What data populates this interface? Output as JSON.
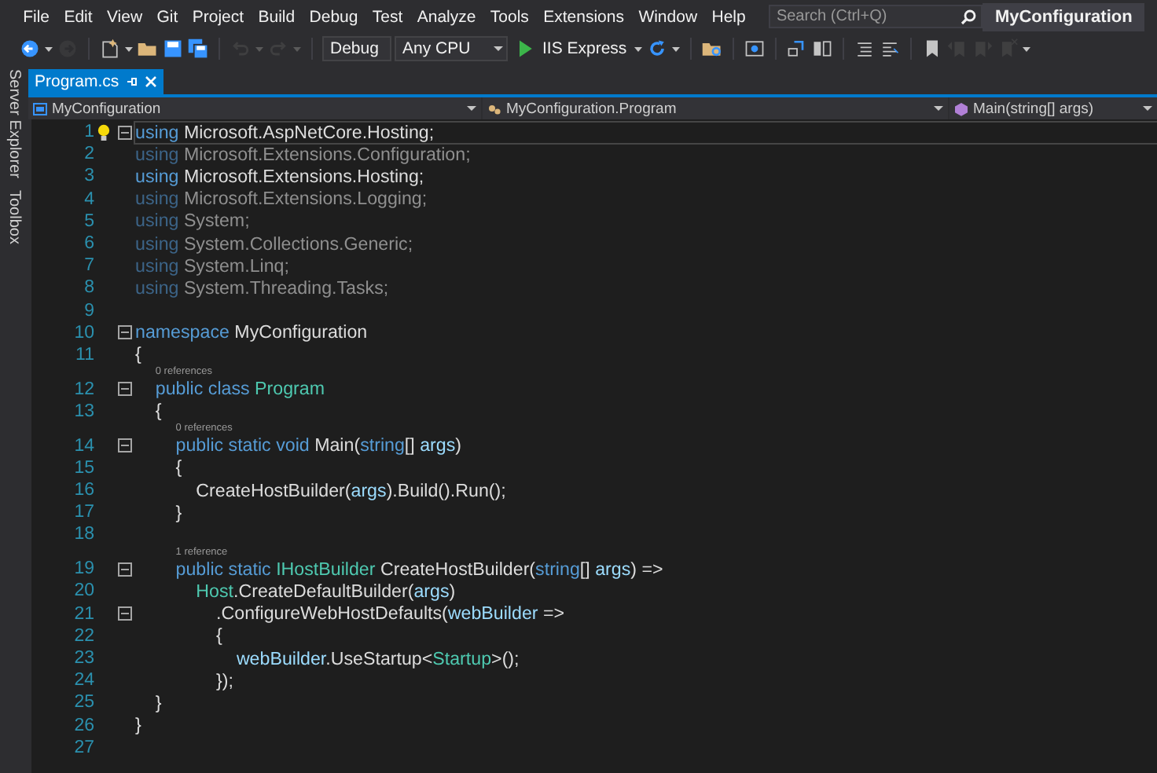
{
  "title_bar": {
    "menu": [
      "File",
      "Edit",
      "View",
      "Git",
      "Project",
      "Build",
      "Debug",
      "Test",
      "Analyze",
      "Tools",
      "Extensions",
      "Window",
      "Help"
    ],
    "search": {
      "placeholder": "Search (Ctrl+Q)"
    },
    "solution": "MyConfiguration"
  },
  "toolbar": [
    {
      "kind": "back",
      "disabled": false
    },
    {
      "kind": "caret",
      "disabled": false
    },
    {
      "kind": "forward",
      "disabled": true
    },
    {
      "kind": "sep"
    },
    {
      "kind": "new",
      "disabled": false
    },
    {
      "kind": "caret",
      "disabled": false
    },
    {
      "kind": "open",
      "disabled": false
    },
    {
      "kind": "save",
      "disabled": false
    },
    {
      "kind": "save-all",
      "disabled": false
    },
    {
      "kind": "sep"
    },
    {
      "kind": "undo",
      "disabled": true
    },
    {
      "kind": "caret",
      "disabled": true
    },
    {
      "kind": "redo",
      "disabled": true
    },
    {
      "kind": "caret",
      "disabled": true
    },
    {
      "kind": "sep"
    },
    {
      "kind": "combo",
      "text": "Debug",
      "disabled": false
    },
    {
      "kind": "combo",
      "text": "Any CPU",
      "disabled": false
    },
    {
      "kind": "run",
      "text": "IIS Express",
      "disabled": false
    },
    {
      "kind": "caret",
      "disabled": false
    },
    {
      "kind": "refresh",
      "disabled": false
    },
    {
      "kind": "caret",
      "disabled": false
    },
    {
      "kind": "sep"
    },
    {
      "kind": "find",
      "disabled": false
    },
    {
      "kind": "sep"
    },
    {
      "kind": "browse",
      "disabled": false
    },
    {
      "kind": "sep"
    },
    {
      "kind": "step",
      "disabled": false
    },
    {
      "kind": "layout",
      "disabled": false
    },
    {
      "kind": "sep"
    },
    {
      "kind": "comment",
      "disabled": false
    },
    {
      "kind": "uncomment",
      "disabled": false
    },
    {
      "kind": "sep"
    },
    {
      "kind": "bookmark",
      "disabled": false
    },
    {
      "kind": "bookmark-prev",
      "disabled": true
    },
    {
      "kind": "bookmark-next",
      "disabled": true
    },
    {
      "kind": "bookmark-clear",
      "disabled": true
    },
    {
      "kind": "caret",
      "disabled": false
    }
  ],
  "side_tabs": [
    "Server Explorer",
    "Toolbox"
  ],
  "tabs": [
    {
      "label": "Program.cs",
      "selected": true
    }
  ],
  "nav_bar": [
    "MyConfiguration",
    "MyConfiguration.Program",
    "Main(string[] args)"
  ],
  "code_lines": [
    {
      "number": "1",
      "fold": true,
      "current": true,
      "lightbulb": true,
      "tokens": [
        {
          "kind": "keyword",
          "text": "using"
        },
        {
          "kind": "plain",
          "text": " Microsoft.AspNetCore.Hosting;"
        }
      ]
    },
    {
      "number": "2",
      "fold": false,
      "current": false,
      "lightbulb": false,
      "tokens": [
        {
          "kind": "dim-keyword",
          "text": "using"
        },
        {
          "kind": "dim",
          "text": " Microsoft.Extensions.Configuration;"
        }
      ]
    },
    {
      "number": "3",
      "fold": false,
      "current": false,
      "lightbulb": false,
      "tokens": [
        {
          "kind": "keyword",
          "text": "using"
        },
        {
          "kind": "plain",
          "text": " Microsoft.Extensions.Hosting;"
        }
      ]
    },
    {
      "number": "4",
      "fold": false,
      "current": false,
      "lightbulb": false,
      "tokens": [
        {
          "kind": "dim-keyword",
          "text": "using"
        },
        {
          "kind": "dim",
          "text": " Microsoft.Extensions.Logging;"
        }
      ]
    },
    {
      "number": "5",
      "fold": false,
      "current": false,
      "lightbulb": false,
      "tokens": [
        {
          "kind": "dim-keyword",
          "text": "using"
        },
        {
          "kind": "dim",
          "text": " System;"
        }
      ]
    },
    {
      "number": "6",
      "fold": false,
      "current": false,
      "lightbulb": false,
      "tokens": [
        {
          "kind": "dim-keyword",
          "text": "using"
        },
        {
          "kind": "dim",
          "text": " System.Collections.Generic;"
        }
      ]
    },
    {
      "number": "7",
      "fold": false,
      "current": false,
      "lightbulb": false,
      "tokens": [
        {
          "kind": "dim-keyword",
          "text": "using"
        },
        {
          "kind": "dim",
          "text": " System.Linq;"
        }
      ]
    },
    {
      "number": "8",
      "fold": false,
      "current": false,
      "lightbulb": false,
      "tokens": [
        {
          "kind": "dim-keyword",
          "text": "using"
        },
        {
          "kind": "dim",
          "text": " System.Threading.Tasks;"
        }
      ]
    },
    {
      "number": "9",
      "fold": false,
      "current": false,
      "lightbulb": false
    },
    {
      "number": "10",
      "fold": true,
      "current": false,
      "lightbulb": false,
      "tokens": [
        {
          "kind": "keyword",
          "text": "namespace"
        },
        {
          "kind": "plain",
          "text": " MyConfiguration"
        }
      ]
    },
    {
      "number": "11",
      "fold": false,
      "current": false,
      "lightbulb": false,
      "tokens": [
        {
          "kind": "plain",
          "text": "{"
        }
      ]
    },
    {
      "number": "12",
      "fold": true,
      "current": false,
      "lightbulb": false,
      "lens": "0 references",
      "tokens": [
        {
          "kind": "keyword",
          "text": "    public class"
        },
        {
          "kind": "type",
          "text": " Program"
        }
      ]
    },
    {
      "number": "13",
      "fold": false,
      "current": false,
      "lightbulb": false,
      "tokens": [
        {
          "kind": "plain",
          "text": "    {"
        }
      ]
    },
    {
      "number": "14",
      "fold": true,
      "current": false,
      "lightbulb": false,
      "lens": "0 references",
      "tokens": [
        {
          "kind": "keyword",
          "text": "        public static void"
        },
        {
          "kind": "plain",
          "text": " Main("
        },
        {
          "kind": "keyword",
          "text": "string"
        },
        {
          "kind": "plain",
          "text": "[] "
        },
        {
          "kind": "param",
          "text": "args"
        },
        {
          "kind": "plain",
          "text": ")"
        }
      ]
    },
    {
      "number": "15",
      "fold": false,
      "current": false,
      "lightbulb": false,
      "tokens": [
        {
          "kind": "plain",
          "text": "        {"
        }
      ]
    },
    {
      "number": "16",
      "fold": false,
      "current": false,
      "lightbulb": false,
      "tokens": [
        {
          "kind": "plain",
          "text": "            CreateHostBuilder("
        },
        {
          "kind": "param",
          "text": "args"
        },
        {
          "kind": "plain",
          "text": ").Build().Run();"
        }
      ]
    },
    {
      "number": "17",
      "fold": false,
      "current": false,
      "lightbulb": false,
      "tokens": [
        {
          "kind": "plain",
          "text": "        }"
        }
      ]
    },
    {
      "number": "18",
      "fold": false,
      "current": false,
      "lightbulb": false
    },
    {
      "number": "19",
      "fold": true,
      "current": false,
      "lightbulb": false,
      "lens": "1 reference",
      "tokens": [
        {
          "kind": "keyword",
          "text": "        public static"
        },
        {
          "kind": "type",
          "text": " IHostBuilder"
        },
        {
          "kind": "plain",
          "text": " CreateHostBuilder("
        },
        {
          "kind": "keyword",
          "text": "string"
        },
        {
          "kind": "plain",
          "text": "[] "
        },
        {
          "kind": "param",
          "text": "args"
        },
        {
          "kind": "plain",
          "text": ") =>"
        }
      ]
    },
    {
      "number": "20",
      "fold": false,
      "current": false,
      "lightbulb": false,
      "tokens": [
        {
          "kind": "type",
          "text": "            Host"
        },
        {
          "kind": "plain",
          "text": ".CreateDefaultBuilder("
        },
        {
          "kind": "param",
          "text": "args"
        },
        {
          "kind": "plain",
          "text": ")"
        }
      ]
    },
    {
      "number": "21",
      "fold": true,
      "current": false,
      "lightbulb": false,
      "tokens": [
        {
          "kind": "plain",
          "text": "                .ConfigureWebHostDefaults("
        },
        {
          "kind": "param",
          "text": "webBuilder"
        },
        {
          "kind": "plain",
          "text": " =>"
        }
      ]
    },
    {
      "number": "22",
      "fold": false,
      "current": false,
      "lightbulb": false,
      "tokens": [
        {
          "kind": "plain",
          "text": "                {"
        }
      ]
    },
    {
      "number": "23",
      "fold": false,
      "current": false,
      "lightbulb": false,
      "tokens": [
        {
          "kind": "param",
          "text": "                    webBuilder"
        },
        {
          "kind": "plain",
          "text": ".UseStartup<"
        },
        {
          "kind": "type",
          "text": "Startup"
        },
        {
          "kind": "plain",
          "text": ">();"
        }
      ]
    },
    {
      "number": "24",
      "fold": false,
      "current": false,
      "lightbulb": false,
      "tokens": [
        {
          "kind": "plain",
          "text": "                });"
        }
      ]
    },
    {
      "number": "25",
      "fold": false,
      "current": false,
      "lightbulb": false,
      "tokens": [
        {
          "kind": "plain",
          "text": "    }"
        }
      ]
    },
    {
      "number": "26",
      "fold": false,
      "current": false,
      "lightbulb": false,
      "tokens": [
        {
          "kind": "plain",
          "text": "}"
        }
      ]
    },
    {
      "number": "27",
      "fold": false,
      "current": false,
      "lightbulb": false
    }
  ]
}
